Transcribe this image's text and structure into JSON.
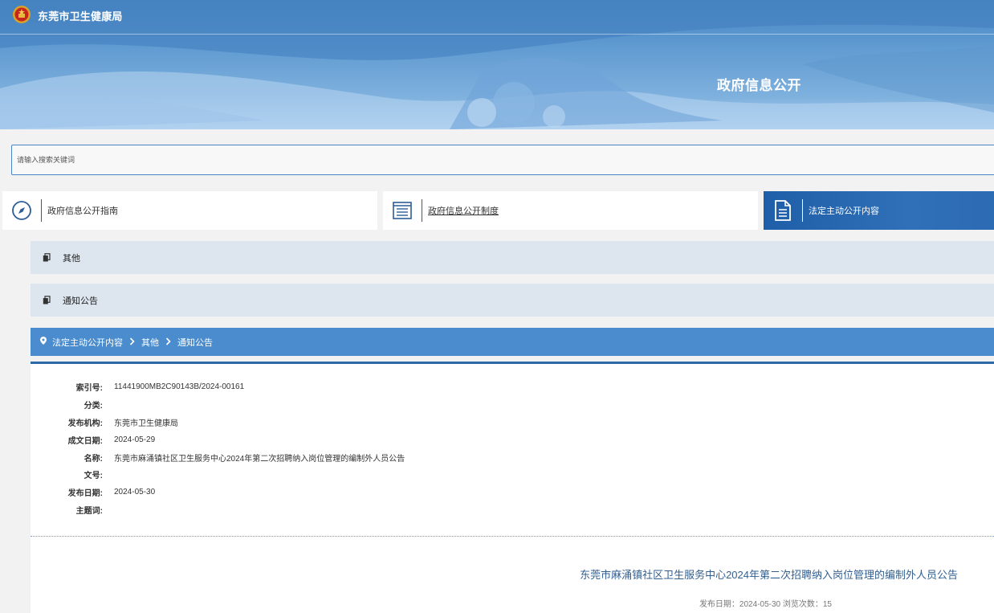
{
  "header": {
    "site_name": "东莞市卫生健康局",
    "banner_title": "政府信息公开",
    "emblem_icon": "national-emblem-icon"
  },
  "search": {
    "placeholder": "请输入搜索关键词"
  },
  "tabs": [
    {
      "label": "政府信息公开指南",
      "icon": "compass-icon",
      "active": false
    },
    {
      "label": "政府信息公开制度",
      "icon": "list-icon",
      "active": false
    },
    {
      "label": "法定主动公开内容",
      "icon": "document-icon",
      "active": true
    }
  ],
  "categories": [
    {
      "label": "其他"
    },
    {
      "label": "通知公告"
    }
  ],
  "breadcrumb": [
    "法定主动公开内容",
    "其他",
    "通知公告"
  ],
  "meta": [
    {
      "key": "索引号:",
      "value": "11441900MB2C90143B/2024-00161"
    },
    {
      "key": "分类:",
      "value": ""
    },
    {
      "key": "发布机构:",
      "value": "东莞市卫生健康局"
    },
    {
      "key": "成文日期:",
      "value": "2024-05-29"
    },
    {
      "key": "名称:",
      "value": "东莞市麻涌镇社区卫生服务中心2024年第二次招聘纳入岗位管理的编制外人员公告"
    },
    {
      "key": "文号:",
      "value": ""
    },
    {
      "key": "发布日期:",
      "value": "2024-05-30"
    },
    {
      "key": "主题词:",
      "value": ""
    }
  ],
  "document": {
    "title": "东莞市麻涌镇社区卫生服务中心2024年第二次招聘纳入岗位管理的编制外人员公告",
    "pub_info": "发布日期：2024-05-30  浏览次数：15"
  },
  "colors": {
    "accent": "#2d69a7",
    "breadcrumb_bg": "#4a8ccd",
    "category_bg": "#dde6ef"
  }
}
